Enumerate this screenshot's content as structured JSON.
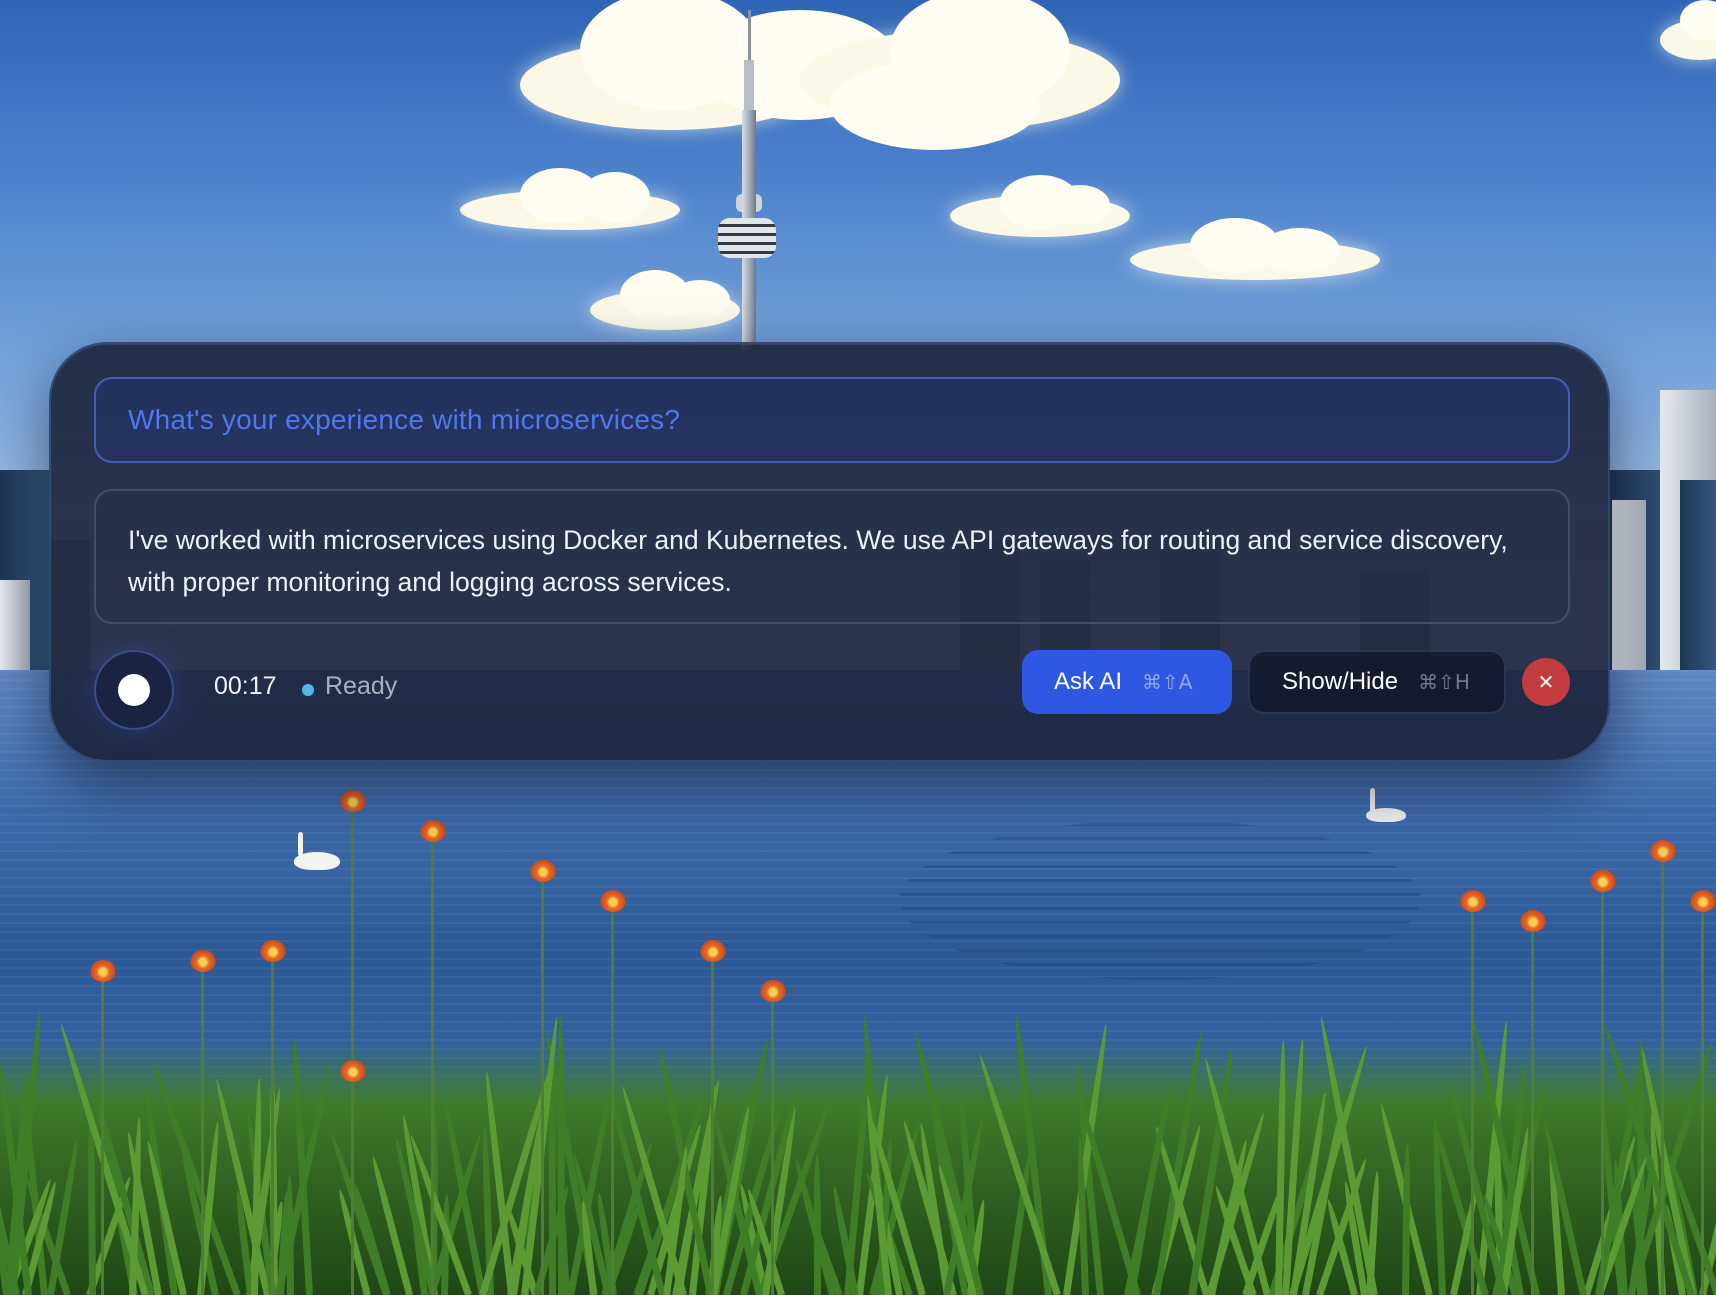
{
  "overlay": {
    "question": "What's your experience with microservices?",
    "answer": "I've worked with microservices using Docker and Kubernetes. We use API gateways for routing and service discovery, with proper monitoring and logging across services.",
    "timer": "00:17",
    "status": "Ready",
    "ask_ai": {
      "label": "Ask AI",
      "shortcut": "⌘⇧A"
    },
    "show_hide": {
      "label": "Show/Hide",
      "shortcut": "⌘⇧H"
    },
    "close_glyph": "✕"
  },
  "icons": {
    "record": "record-dot-icon",
    "status": "status-dot-icon",
    "close": "close-icon"
  },
  "colors": {
    "question_text": "#4d78ef",
    "primary_button": "#2e57e3",
    "close_button": "#c23b3e",
    "status_dot": "#4fb8e6"
  }
}
